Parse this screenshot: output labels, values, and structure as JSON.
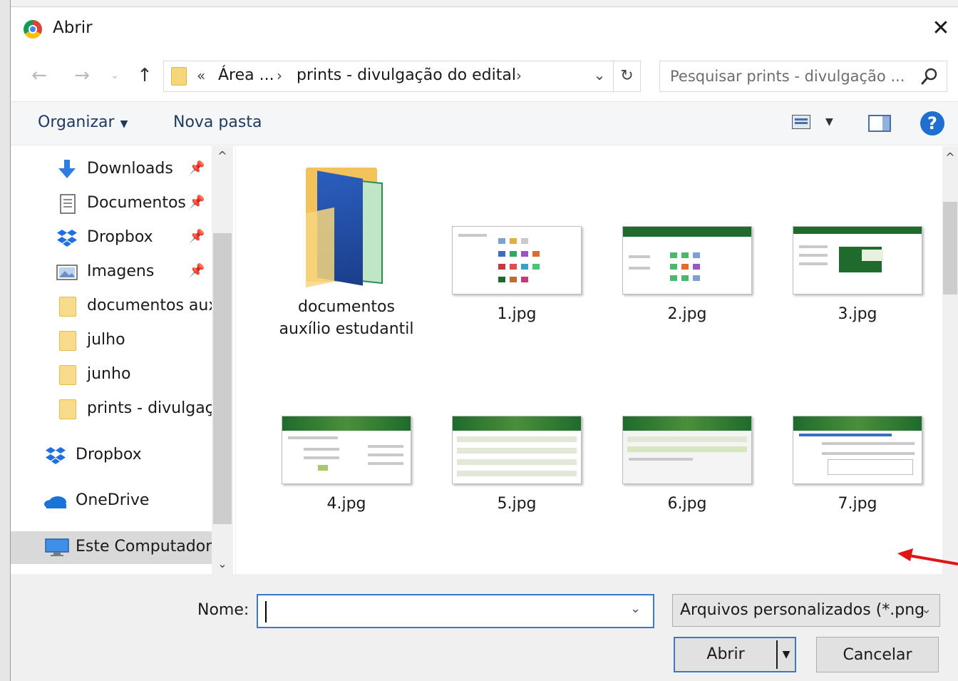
{
  "window": {
    "title": "Abrir",
    "close_glyph": "✕"
  },
  "nav": {
    "back_glyph": "←",
    "forward_glyph": "→",
    "recent_glyph": "⌄",
    "up_glyph": "↑",
    "address": {
      "chevron": "«",
      "parts": [
        "Área ...",
        "prints - divulgação do edital"
      ],
      "separator": "›",
      "dropdown_glyph": "⌄",
      "refresh_glyph": "↻"
    },
    "search": {
      "placeholder": "Pesquisar prints - divulgação ..."
    }
  },
  "toolbar": {
    "organize_label": "Organizar",
    "organize_caret": "▼",
    "new_folder_label": "Nova pasta",
    "view_caret": "▼",
    "help_glyph": "?"
  },
  "sidebar": {
    "pin_glyph": "📌",
    "items": [
      {
        "label": "Downloads",
        "icon": "download-icon",
        "pinned": true
      },
      {
        "label": "Documentos",
        "icon": "document-icon",
        "pinned": true
      },
      {
        "label": "Dropbox",
        "icon": "dropbox-icon",
        "pinned": true
      },
      {
        "label": "Imagens",
        "icon": "pictures-icon",
        "pinned": true
      },
      {
        "label": "documentos aux",
        "icon": "folder-icon",
        "pinned": false
      },
      {
        "label": "julho",
        "icon": "folder-icon",
        "pinned": false
      },
      {
        "label": "junho",
        "icon": "folder-icon",
        "pinned": false
      },
      {
        "label": "prints - divulgaç",
        "icon": "folder-icon",
        "pinned": false
      },
      {
        "label": "Dropbox",
        "icon": "dropbox-icon",
        "pinned": false
      },
      {
        "label": "OneDrive",
        "icon": "onedrive-icon",
        "pinned": false
      },
      {
        "label": "Este Computador",
        "icon": "computer-icon",
        "pinned": false,
        "selected": true
      }
    ],
    "scroll_up_glyph": "^",
    "scroll_down_glyph": "⌄"
  },
  "files": {
    "folder": {
      "line1": "documentos",
      "line2": "auxílio estudantil"
    },
    "images": [
      "1.jpg",
      "2.jpg",
      "3.jpg",
      "4.jpg",
      "5.jpg",
      "6.jpg",
      "7.jpg"
    ]
  },
  "footer": {
    "name_label": "Nome:",
    "name_value": "",
    "name_dropdown_glyph": "⌄",
    "filetype_label": "Arquivos personalizados (*.png",
    "filetype_dropdown_glyph": "⌄",
    "open_label": "Abrir",
    "open_split_glyph": "▼",
    "cancel_label": "Cancelar"
  },
  "colors": {
    "accent_blue": "#3a78c9",
    "help_blue": "#1f6fd1",
    "folder_yellow": "#f8dc8c",
    "thumbnail_green": "#1f6b2d",
    "annotation_red": "#e01515"
  }
}
